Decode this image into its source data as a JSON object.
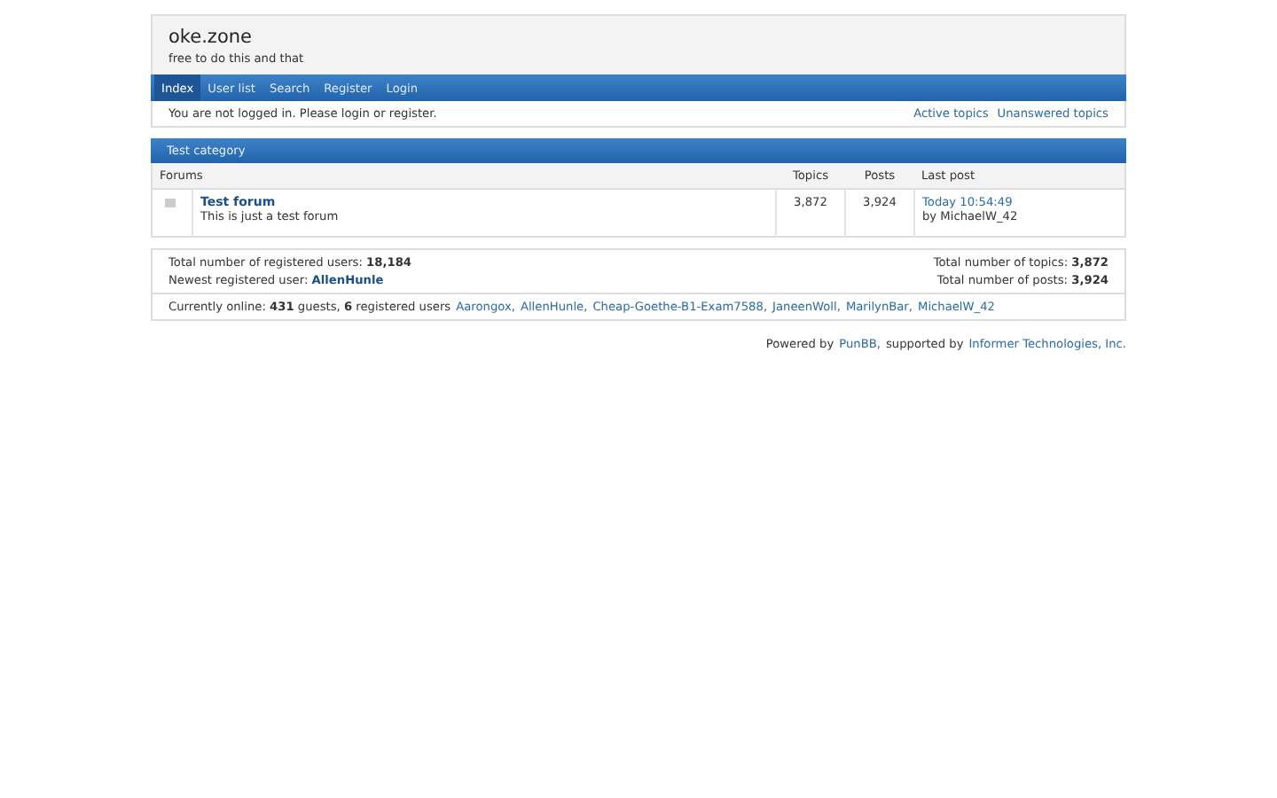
{
  "board": {
    "title": "oke.zone",
    "description": "free to do this and that"
  },
  "nav": [
    {
      "label": "Index",
      "selected": true
    },
    {
      "label": "User list",
      "selected": false
    },
    {
      "label": "Search",
      "selected": false
    },
    {
      "label": "Register",
      "selected": false
    },
    {
      "label": "Login",
      "selected": false
    }
  ],
  "notice": {
    "message": "You are not logged in. Please login or register.",
    "links": [
      "Active topics",
      "Unanswered topics"
    ]
  },
  "category": {
    "title": "Test category",
    "columns": [
      "Forums",
      "Topics",
      "Posts",
      "Last post"
    ],
    "forums": [
      {
        "name": "Test forum",
        "description": "This is just a test forum",
        "topics": "3,872",
        "posts": "3,924",
        "last_post_time": "Today 10:54:49",
        "last_post_by": "by MichaelW_42"
      }
    ]
  },
  "stats": {
    "left": [
      "Total number of registered users: **18,184**",
      "Newest registered user:"
    ],
    "newest_user": "AllenHunle",
    "right": [
      "Total number of topics: **3,872**",
      "Total number of posts: **3,924**"
    ]
  },
  "online": {
    "summary": "Currently online: **431** guests, **6** registered users",
    "users": [
      "Aarongox,",
      "AllenHunle,",
      "Cheap-Goethe-B1-Exam7588,",
      "JaneenWoll,",
      "MarilynBar,",
      "MichaelW_42"
    ]
  },
  "footer": {
    "before": "Powered by",
    "link1": "PunBB,",
    "middle": "supported by",
    "link2": "Informer Technologies, Inc."
  }
}
